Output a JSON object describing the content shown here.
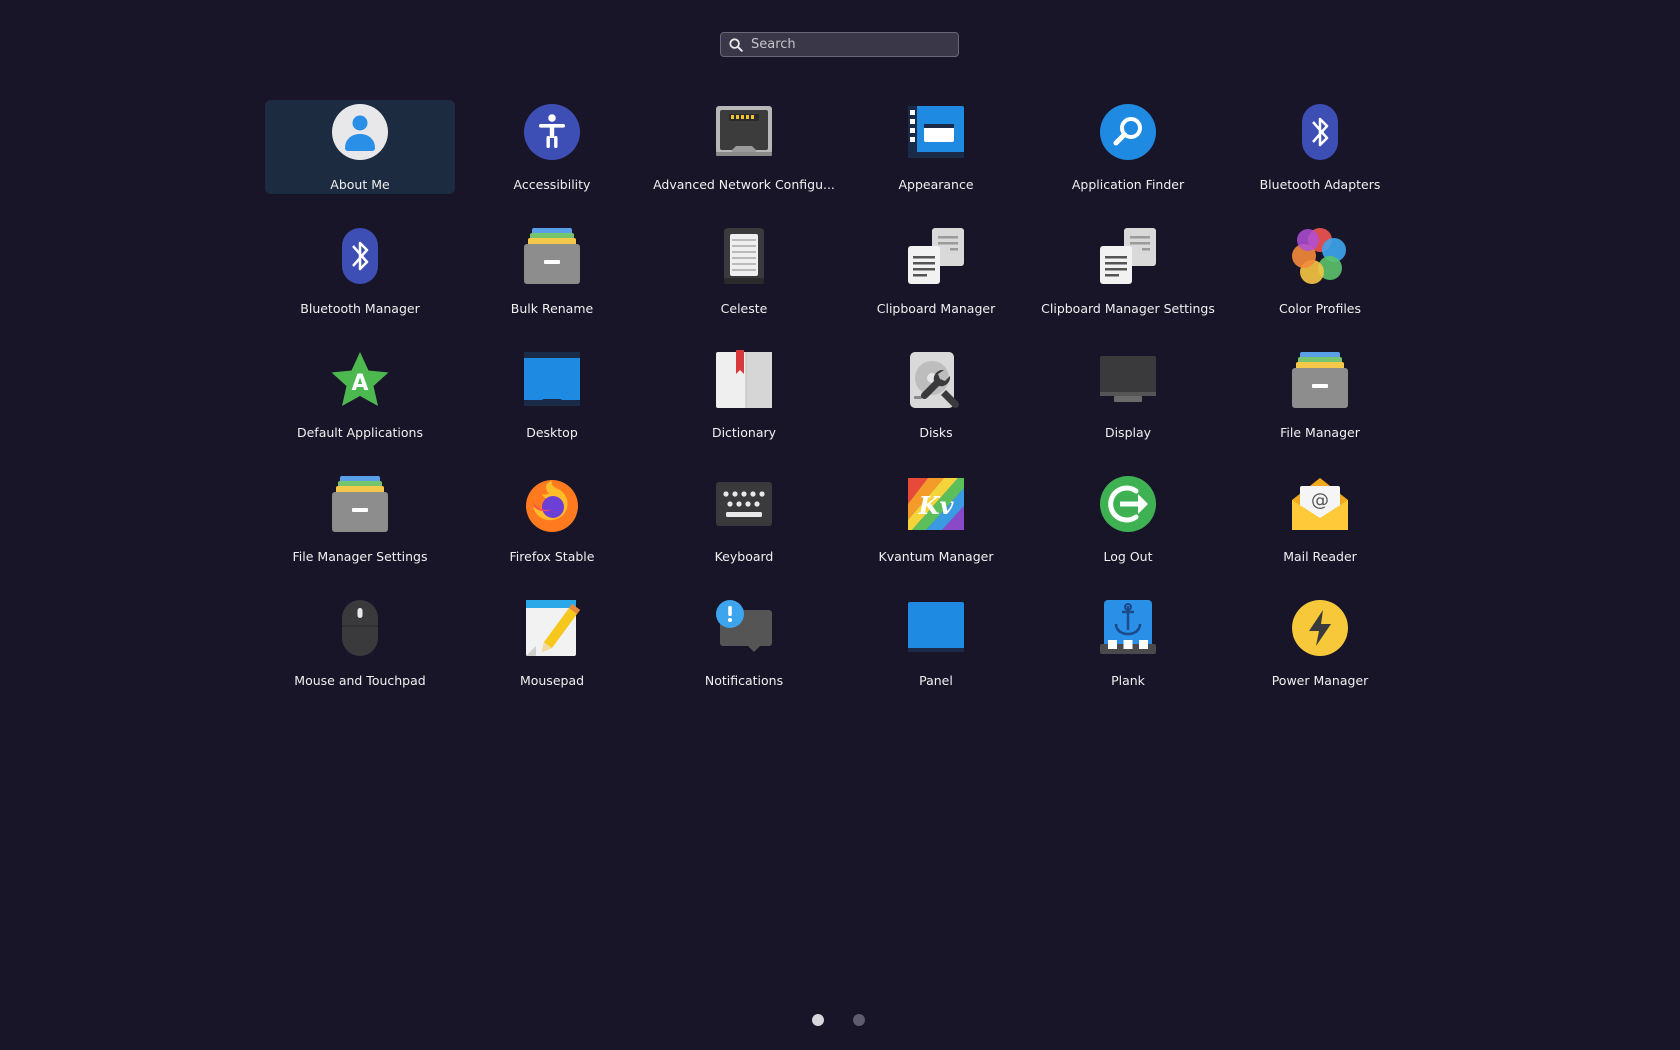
{
  "search": {
    "placeholder": "Search"
  },
  "apps": [
    {
      "label": "About Me",
      "icon": "user-icon",
      "selected": true
    },
    {
      "label": "Accessibility",
      "icon": "accessibility-icon"
    },
    {
      "label": "Advanced Network Configu...",
      "icon": "network-port-icon"
    },
    {
      "label": "Appearance",
      "icon": "appearance-icon"
    },
    {
      "label": "Application Finder",
      "icon": "app-finder-icon"
    },
    {
      "label": "Bluetooth Adapters",
      "icon": "bluetooth-icon"
    },
    {
      "label": "Bluetooth Manager",
      "icon": "bluetooth-icon"
    },
    {
      "label": "Bulk Rename",
      "icon": "file-cabinet-icon"
    },
    {
      "label": "Celeste",
      "icon": "celeste-icon"
    },
    {
      "label": "Clipboard Manager",
      "icon": "clipboard-icon"
    },
    {
      "label": "Clipboard Manager Settings",
      "icon": "clipboard-icon"
    },
    {
      "label": "Color Profiles",
      "icon": "color-profiles-icon"
    },
    {
      "label": "Default Applications",
      "icon": "default-apps-star-icon"
    },
    {
      "label": "Desktop",
      "icon": "desktop-icon"
    },
    {
      "label": "Dictionary",
      "icon": "dictionary-book-icon"
    },
    {
      "label": "Disks",
      "icon": "disks-wrench-icon"
    },
    {
      "label": "Display",
      "icon": "display-monitor-icon"
    },
    {
      "label": "File Manager",
      "icon": "file-cabinet-icon"
    },
    {
      "label": "File Manager Settings",
      "icon": "file-cabinet-icon"
    },
    {
      "label": "Firefox Stable",
      "icon": "firefox-icon"
    },
    {
      "label": "Keyboard",
      "icon": "keyboard-icon"
    },
    {
      "label": "Kvantum Manager",
      "icon": "kvantum-icon"
    },
    {
      "label": "Log Out",
      "icon": "logout-icon"
    },
    {
      "label": "Mail Reader",
      "icon": "mail-icon"
    },
    {
      "label": "Mouse and Touchpad",
      "icon": "mouse-icon"
    },
    {
      "label": "Mousepad",
      "icon": "text-editor-icon"
    },
    {
      "label": "Notifications",
      "icon": "notifications-icon"
    },
    {
      "label": "Panel",
      "icon": "panel-icon"
    },
    {
      "label": "Plank",
      "icon": "plank-dock-icon"
    },
    {
      "label": "Power Manager",
      "icon": "power-bolt-icon"
    }
  ],
  "kvantum_glyph": "Kv",
  "default_apps_glyph": "A",
  "pagination": {
    "pages": 2,
    "current": 1
  }
}
